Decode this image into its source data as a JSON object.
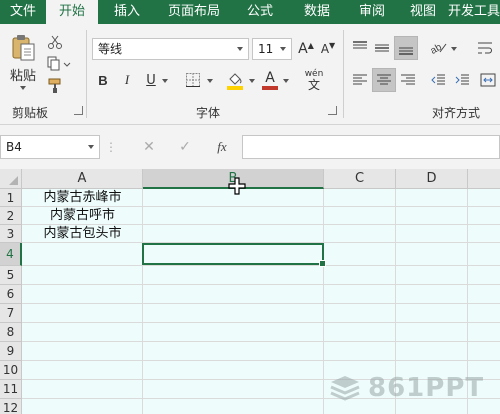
{
  "ribbon_tabs": [
    {
      "label": "文件",
      "active": false
    },
    {
      "label": "开始",
      "active": true
    },
    {
      "label": "插入",
      "active": false
    },
    {
      "label": "页面布局",
      "active": false
    },
    {
      "label": "公式",
      "active": false
    },
    {
      "label": "数据",
      "active": false
    },
    {
      "label": "审阅",
      "active": false
    },
    {
      "label": "视图",
      "active": false
    },
    {
      "label": "开发工具",
      "active": false
    }
  ],
  "clipboard": {
    "paste_label": "粘贴",
    "group_label": "剪贴板"
  },
  "font": {
    "font_name": "等线",
    "font_size": "11",
    "bold_label": "B",
    "italic_label": "I",
    "underline_label": "U",
    "grow_label": "A",
    "shrink_label": "A",
    "font_color_label": "A",
    "pinyin_label": "wén",
    "pinyin_char": "文",
    "group_label": "字体",
    "font_color": "#c0392b",
    "fill_color": "#ffd200"
  },
  "alignment": {
    "group_label": "对齐方式"
  },
  "formula_bar": {
    "name_box": "B4",
    "fx_label": "fx",
    "formula": ""
  },
  "columns": [
    "A",
    "B",
    "C",
    "D"
  ],
  "selected_column": "B",
  "rows": [
    "1",
    "2",
    "3",
    "4",
    "5",
    "6",
    "7",
    "8",
    "9",
    "10",
    "11",
    "12"
  ],
  "selected_row": "4",
  "cells": {
    "A1": "内蒙古赤峰市",
    "A2": "内蒙古呼市",
    "A3": "内蒙古包头市"
  },
  "active_cell": "B4",
  "watermark": "861PPT",
  "accent_color": "#217346"
}
